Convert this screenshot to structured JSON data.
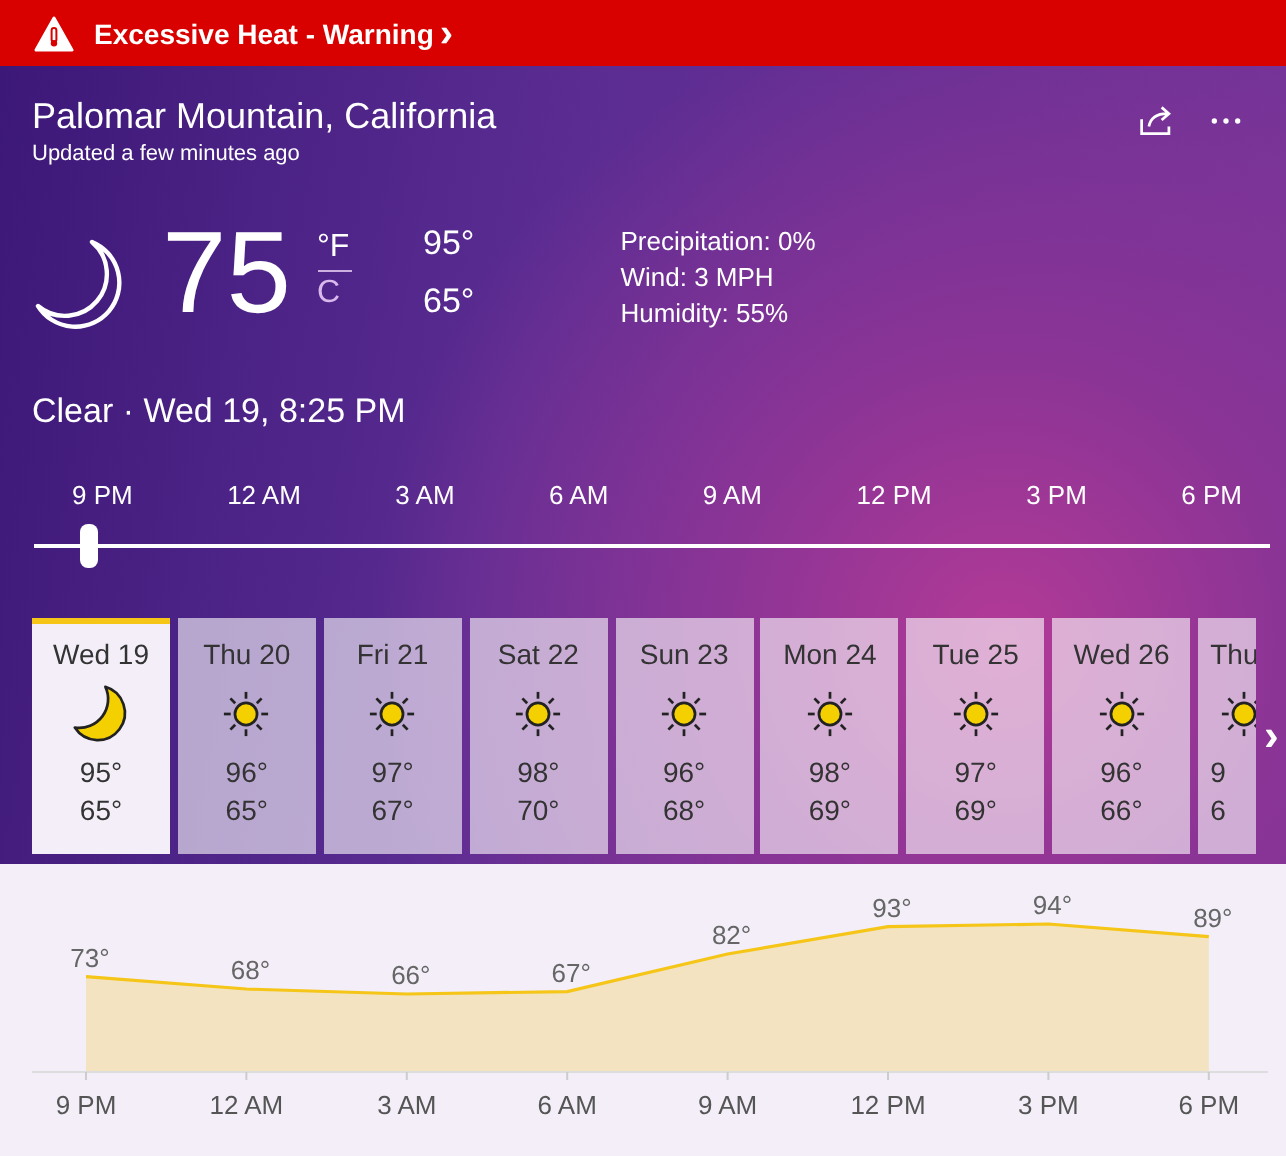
{
  "alert": {
    "title": "Excessive Heat - Warning",
    "chevron": "›"
  },
  "location": {
    "name": "Palomar Mountain, California",
    "updated": "Updated a few minutes ago"
  },
  "current": {
    "kind": "moon",
    "temperature": "75",
    "units": [
      {
        "label": "°F",
        "selected": true
      },
      {
        "label": "C",
        "selected": false
      }
    ],
    "high": "95°",
    "low": "65°",
    "details": [
      "Precipitation: 0%",
      "Wind: 3 MPH",
      "Humidity: 55%"
    ],
    "summary": "Clear · Wed 19, 8:25 PM"
  },
  "timeline": {
    "labels": [
      "9 PM",
      "12 AM",
      "3 AM",
      "6 AM",
      "9 AM",
      "12 PM",
      "3 PM",
      "6 PM"
    ],
    "level": 0.02
  },
  "days": [
    {
      "day": "Wed 19",
      "kind": "moon",
      "high": "95°",
      "low": "65°",
      "selected": true
    },
    {
      "day": "Thu 20",
      "kind": "sun",
      "high": "96°",
      "low": "65°",
      "selected": false
    },
    {
      "day": "Fri 21",
      "kind": "sun",
      "high": "97°",
      "low": "67°",
      "selected": false
    },
    {
      "day": "Sat 22",
      "kind": "sun",
      "high": "98°",
      "low": "70°",
      "selected": false
    },
    {
      "day": "Sun 23",
      "kind": "sun",
      "high": "96°",
      "low": "68°",
      "selected": false
    },
    {
      "day": "Mon 24",
      "kind": "sun",
      "high": "98°",
      "low": "69°",
      "selected": false
    },
    {
      "day": "Tue 25",
      "kind": "sun",
      "high": "97°",
      "low": "69°",
      "selected": false
    },
    {
      "day": "Wed 26",
      "kind": "sun",
      "high": "96°",
      "low": "66°",
      "selected": false
    },
    {
      "day": "Thu",
      "kind": "sun",
      "high": "9",
      "low": "6",
      "selected": false
    }
  ],
  "next_arrow": "›",
  "hourly": {
    "label_suffix": "°",
    "chart_data": {
      "type": "area",
      "categories": [
        "9 PM",
        "12 AM",
        "3 AM",
        "6 AM",
        "9 AM",
        "12 PM",
        "3 PM",
        "6 PM"
      ],
      "series": [
        {
          "color": "#f5c518",
          "values": [
            73,
            68,
            66,
            67,
            82,
            93,
            94,
            89
          ]
        }
      ],
      "data_labels": true
    }
  }
}
